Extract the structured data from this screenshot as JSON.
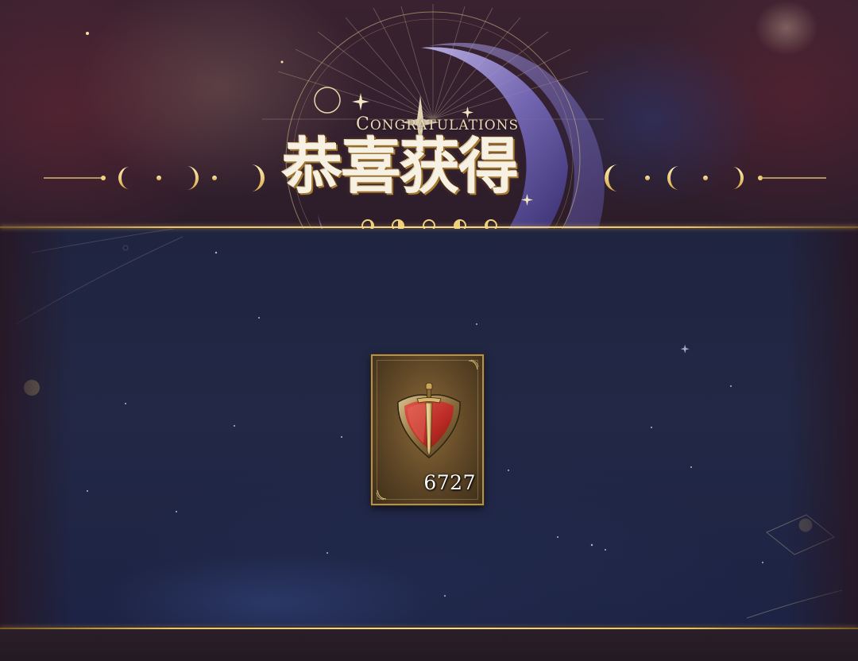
{
  "banner": {
    "title": "恭喜获得",
    "subtitle_first": "C",
    "subtitle_rest": "ONGRATULATIONS"
  },
  "reward": {
    "icon": "shield-sword-icon",
    "count": "6727"
  },
  "colors": {
    "gold": "#e8c46a",
    "panel": "#1f2440",
    "card_border": "#b39150"
  }
}
